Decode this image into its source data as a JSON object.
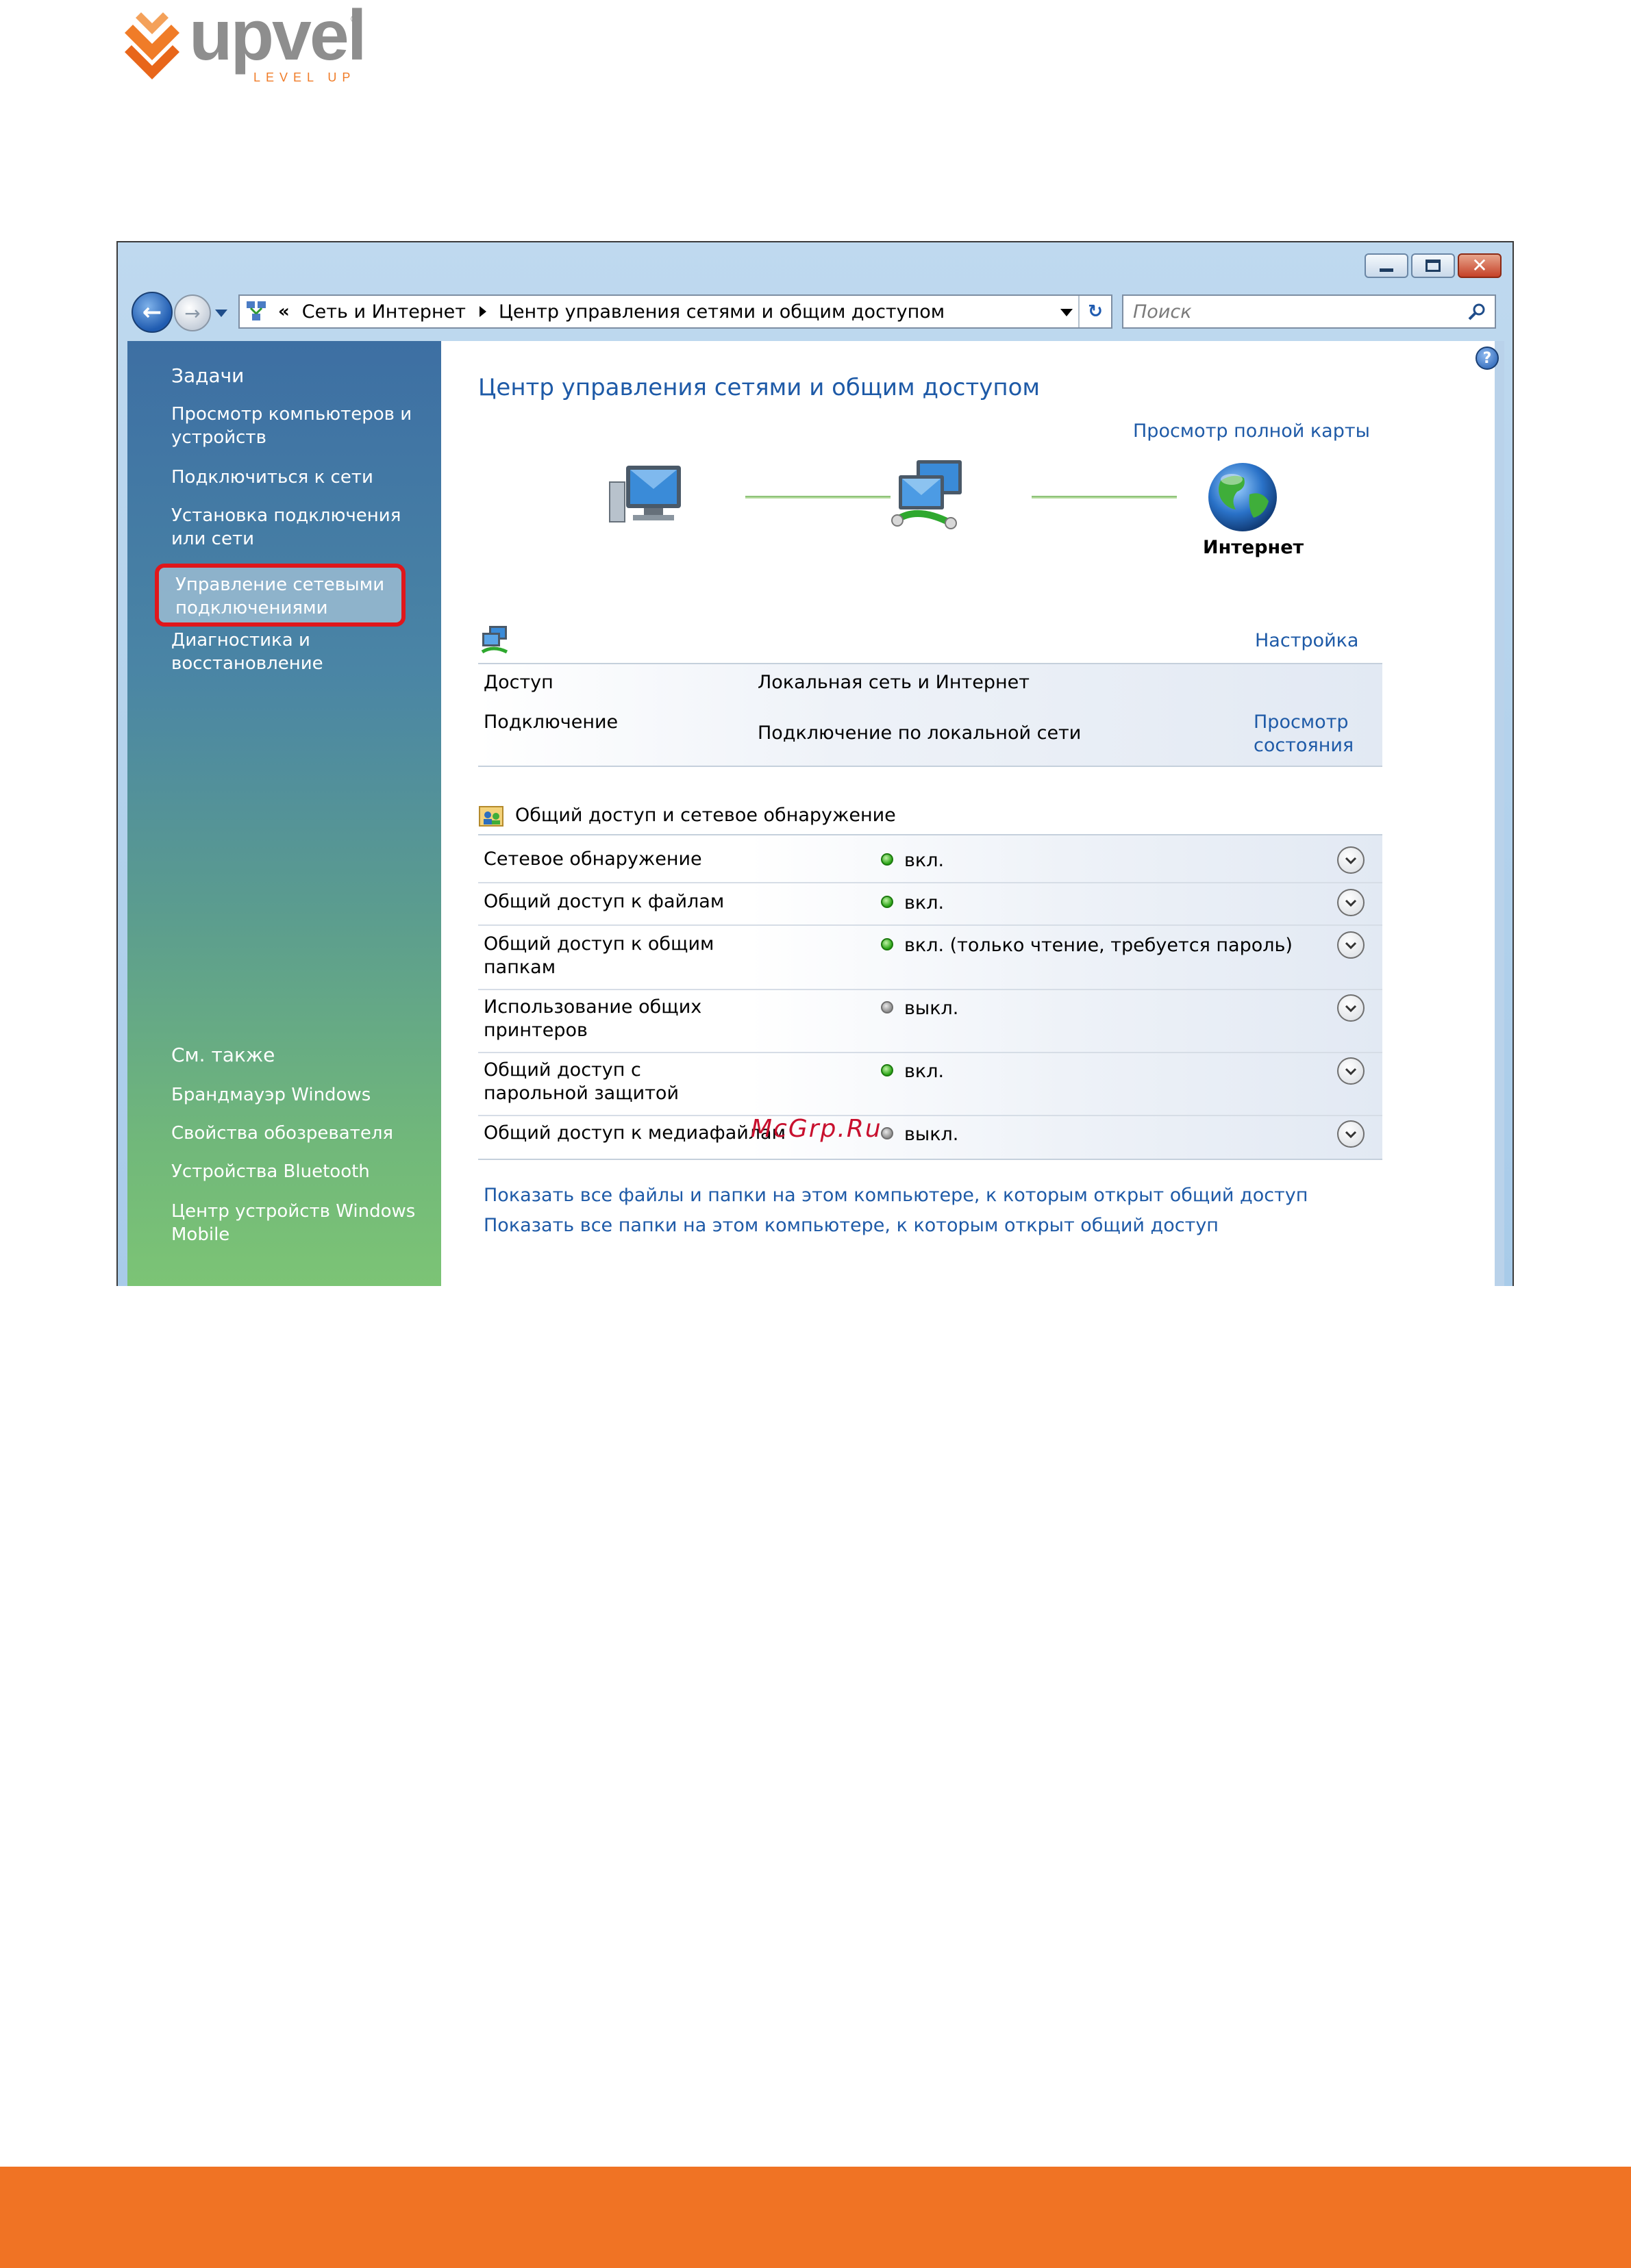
{
  "brand": {
    "name": "upvel",
    "tagline": "LEVEL UP",
    "registered": "®",
    "accent": "#f07324",
    "logo_gray": "#8e8e8e"
  },
  "window": {
    "controls": {
      "minimize": "minimize-icon",
      "maximize": "maximize-icon",
      "close": "close-icon"
    },
    "address": {
      "chevron": "«",
      "segments": [
        "Сеть и Интернет",
        "Центр управления сетями и общим доступом"
      ]
    },
    "search": {
      "placeholder": "Поиск"
    },
    "help": "?"
  },
  "sidebar": {
    "tasks_heading": "Задачи",
    "tasks": [
      "Просмотр компьютеров и устройств",
      "Подключиться к сети",
      "Установка подключения или сети",
      "Управление сетевыми подключениями",
      "Диагностика и восстановление"
    ],
    "see_also_heading": "См. также",
    "see_also": [
      "Брандмауэр Windows",
      "Свойства обозревателя",
      "Устройства Bluetooth",
      "Центр устройств Windows Mobile"
    ],
    "highlight_color": "#e0161b"
  },
  "main": {
    "title": "Центр управления сетями и общим доступом",
    "full_map_link": "Просмотр полной карты",
    "internet_label": "Интернет",
    "network": {
      "customize_link": "Настройка",
      "access_label": "Доступ",
      "access_value": "Локальная сеть и Интернет",
      "connection_label": "Подключение",
      "connection_value": "Подключение по локальной сети",
      "view_status_link": "Просмотр состояния"
    },
    "sharing": {
      "heading": "Общий доступ и сетевое обнаружение",
      "rows": [
        {
          "label": "Сетевое обнаружение",
          "state": "on",
          "value": "вкл."
        },
        {
          "label": "Общий доступ к файлам",
          "state": "on",
          "value": "вкл."
        },
        {
          "label": "Общий доступ к общим папкам",
          "state": "on",
          "value": "вкл. (только чтение, требуется пароль)"
        },
        {
          "label": "Использование общих принтеров",
          "state": "off",
          "value": "выкл."
        },
        {
          "label": "Общий доступ с парольной защитой",
          "state": "on",
          "value": "вкл."
        },
        {
          "label": "Общий доступ к медиафайлам",
          "state": "off",
          "value": "выкл."
        }
      ]
    },
    "bottom_links": [
      "Показать все файлы и папки на этом компьютере, к которым открыт общий доступ",
      "Показать все папки на этом компьютере, к которым открыт общий доступ"
    ]
  },
  "watermark": "McGrp.Ru"
}
